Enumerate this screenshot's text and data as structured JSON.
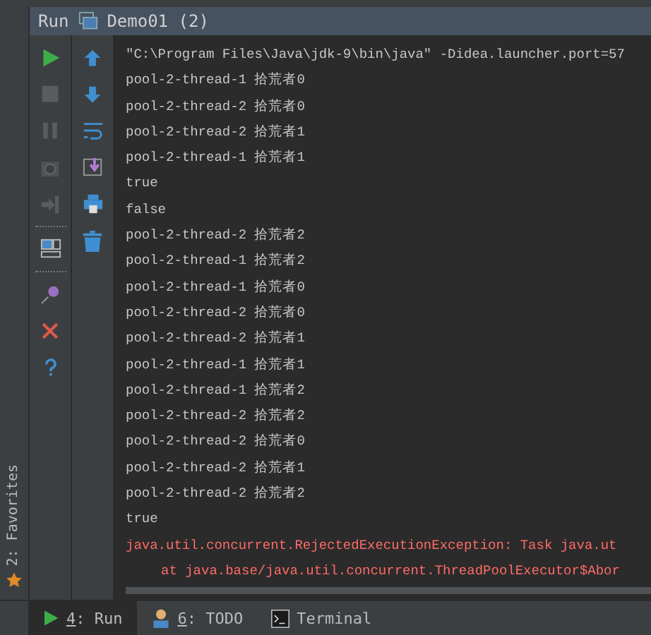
{
  "run_header": {
    "label": "Run",
    "config": "Demo01 (2)"
  },
  "left_strip": {
    "favorites": "2: Favorites"
  },
  "console": {
    "lines": [
      {
        "kind": "out",
        "text": "\"C:\\Program Files\\Java\\jdk-9\\bin\\java\" -Didea.launcher.port=57"
      },
      {
        "kind": "out",
        "text": "pool-2-thread-1 拾荒者0"
      },
      {
        "kind": "out",
        "text": "pool-2-thread-2 拾荒者0"
      },
      {
        "kind": "out",
        "text": "pool-2-thread-2 拾荒者1"
      },
      {
        "kind": "out",
        "text": "pool-2-thread-1 拾荒者1"
      },
      {
        "kind": "out",
        "text": "true"
      },
      {
        "kind": "out",
        "text": "false"
      },
      {
        "kind": "out",
        "text": "pool-2-thread-2 拾荒者2"
      },
      {
        "kind": "out",
        "text": "pool-2-thread-1 拾荒者2"
      },
      {
        "kind": "out",
        "text": "pool-2-thread-1 拾荒者0"
      },
      {
        "kind": "out",
        "text": "pool-2-thread-2 拾荒者0"
      },
      {
        "kind": "out",
        "text": "pool-2-thread-2 拾荒者1"
      },
      {
        "kind": "out",
        "text": "pool-2-thread-1 拾荒者1"
      },
      {
        "kind": "out",
        "text": "pool-2-thread-1 拾荒者2"
      },
      {
        "kind": "out",
        "text": "pool-2-thread-2 拾荒者2"
      },
      {
        "kind": "out",
        "text": "pool-2-thread-2 拾荒者0"
      },
      {
        "kind": "out",
        "text": "pool-2-thread-2 拾荒者1"
      },
      {
        "kind": "out",
        "text": "pool-2-thread-2 拾荒者2"
      },
      {
        "kind": "out",
        "text": "true"
      },
      {
        "kind": "err",
        "text": "java.util.concurrent.RejectedExecutionException: Task java.ut"
      },
      {
        "kind": "err_trace",
        "text": "at java.base/java.util.concurrent.ThreadPoolExecutor$Abor"
      }
    ]
  },
  "bottom_tabs": [
    {
      "number": "4",
      "label": ": Run",
      "selected": true
    },
    {
      "number": "6",
      "label": ": TODO",
      "selected": false
    },
    {
      "label": "Terminal",
      "selected": false
    }
  ]
}
